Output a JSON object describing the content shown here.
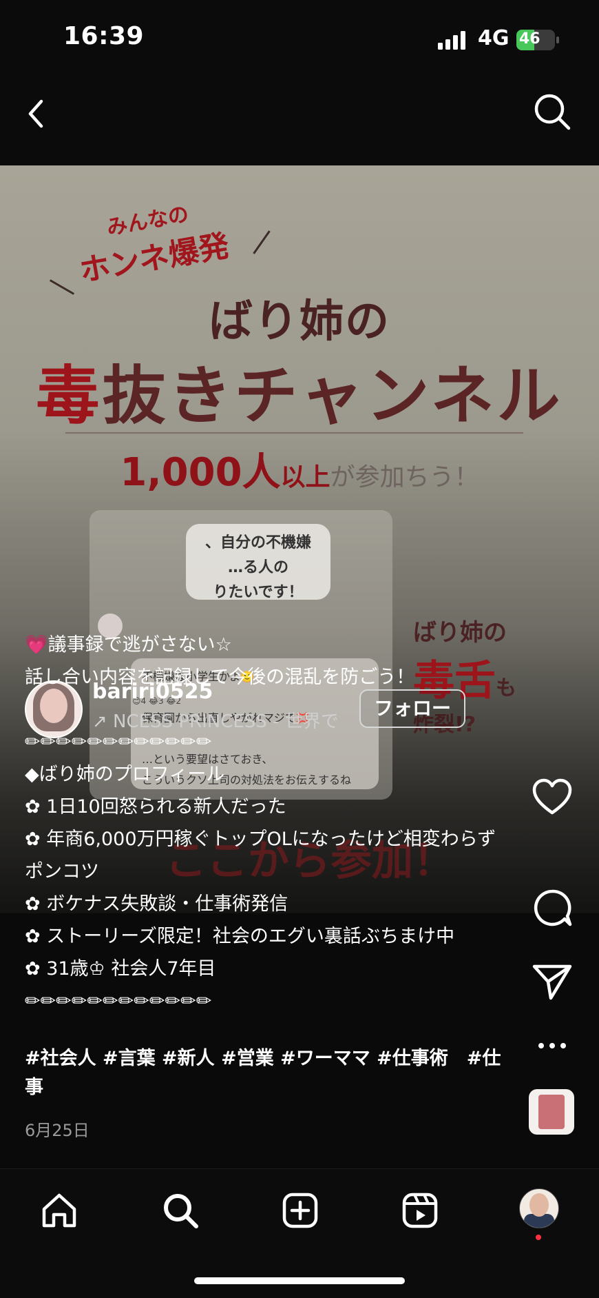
{
  "status": {
    "time": "16:39",
    "network": "4G",
    "battery": "46",
    "battery_level": 0.46
  },
  "poster": {
    "sub1": "みんなの",
    "sub2": "ホンネ爆発",
    "title1": "ばり姉の",
    "title2_red": "毒",
    "title2_rest": "抜きチャンネル",
    "count_num": "1,000人",
    "count_small": "以上",
    "count_rest": "が参加ちう！",
    "card_bubble": "、自分の不機嫌\n…る人の\nりたいです！",
    "card_reacts": "😊4 😂3 😂2",
    "card_reply": "不機嫌な小学生かよ🙂\n\n保育園から出直しやがれマジで💢\n\n…という要望はさておき、\nこういうクソ上司の対処法をお伝えするね",
    "side_a": "ばり姉の",
    "side_b": "毒舌",
    "side_b2": "も",
    "side_c": "炸裂!?",
    "cta": "ここから参加！"
  },
  "author": {
    "username": "bariri0525",
    "music": "↗ NCESS PRINCESS - 世界で",
    "follow_label": "フォロー"
  },
  "caption": {
    "lines": [
      "💗議事録で逃がさない☆",
      "話し合い内容を記録して今後の混乱を防ごう！",
      "",
      "✏✏✏✏✏✏✏✏✏✏✏✏",
      "◆ばり姉のプロフィール",
      "✿ 1日10回怒られる新人だった",
      "✿ 年商6,000万円稼ぐトップOLになったけど相変わらずポンコツ",
      "✿ ボケナス失敗談・仕事術発信",
      "✿ ストーリーズ限定！社会のエグい裏話ぶちまけ中",
      "✿ 31歳♔ 社会人7年目",
      "✏✏✏✏✏✏✏✏✏✏✏✏"
    ],
    "hashtags": "#社会人 #言葉 #新人 #営業 #ワーママ #仕事術　#仕事",
    "date": "6月25日"
  },
  "icons": {
    "back": "chevron-left-icon",
    "search": "search-icon",
    "like": "heart-icon",
    "comment": "comment-icon",
    "share": "send-icon",
    "more": "more-icon"
  }
}
